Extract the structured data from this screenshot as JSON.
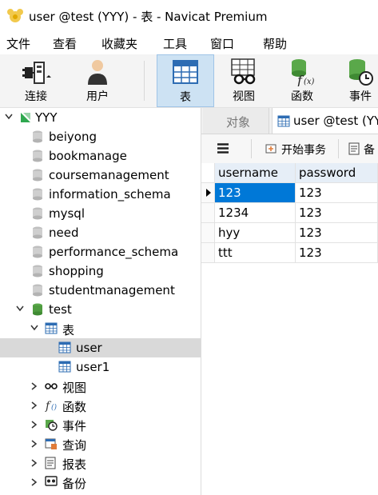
{
  "window": {
    "title": "user @test (YYY) - 表 - Navicat Premium"
  },
  "menu": [
    "文件",
    "查看",
    "收藏夹",
    "工具",
    "窗口",
    "帮助"
  ],
  "toolbar": {
    "connect": "连接",
    "user": "用户",
    "table": "表",
    "view": "视图",
    "function": "函数",
    "event": "事件"
  },
  "tree": {
    "connection": "YYY",
    "databases": [
      "beiyong",
      "bookmanage",
      "coursemanagement",
      "information_schema",
      "mysql",
      "need",
      "performance_schema",
      "shopping",
      "studentmanagement"
    ],
    "open_db": "test",
    "tables_group": "表",
    "tables": [
      "user",
      "user1"
    ],
    "groups": [
      "视图",
      "函数",
      "事件",
      "查询",
      "报表",
      "备份"
    ]
  },
  "tabs": {
    "objects": "对象",
    "active": "user @test (YY"
  },
  "subtoolbar": {
    "begin_transaction": "开始事务",
    "backup": "备"
  },
  "grid": {
    "columns": [
      "username",
      "password"
    ],
    "rows": [
      [
        "123",
        "123"
      ],
      [
        "1234",
        "123"
      ],
      [
        "hyy",
        "123"
      ],
      [
        "ttt",
        "123"
      ]
    ]
  },
  "colors": {
    "accent": "#0078d7",
    "active_tool": "#cde2f3",
    "selected_row": "#d9d9d9"
  }
}
